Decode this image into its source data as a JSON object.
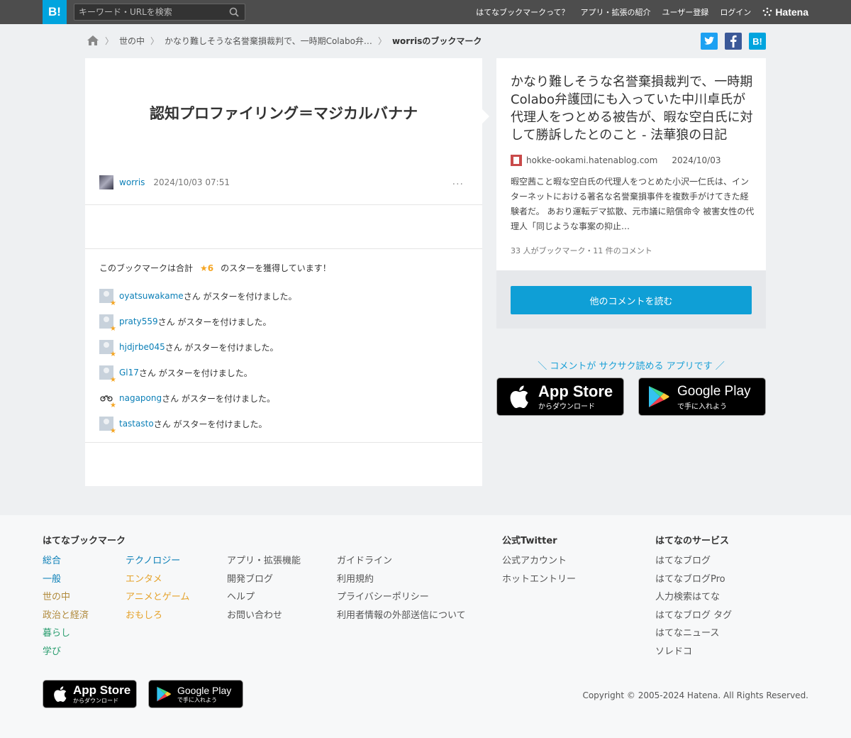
{
  "header": {
    "logo": "B!",
    "search_placeholder": "キーワード・URLを検索",
    "nav": [
      "はてなブックマークって？",
      "アプリ・拡張の紹介",
      "ユーザー登録",
      "ログイン"
    ],
    "hatena_label": "Hatena"
  },
  "breadcrumb": {
    "category": "世の中",
    "entry": "かなり難しそうな名誉棄損裁判で、一時期Colabo弁…",
    "current": "worrisのブックマーク"
  },
  "share": {
    "hatena": "B!"
  },
  "bookmark": {
    "comment": "認知プロファイリング＝マジカルバナナ",
    "user": "worris",
    "timestamp": "2024/10/03 07:51",
    "more": "···",
    "star_prefix": "このブックマークは合計",
    "star_count": "★6",
    "star_suffix": "のスターを獲得しています！",
    "star_users": [
      {
        "name": "oyatsuwakame",
        "suffix": "さん がスターを付けました。"
      },
      {
        "name": "praty559",
        "suffix": "さん がスターを付けました。"
      },
      {
        "name": "hjdjrbe045",
        "suffix": "さん がスターを付けました。"
      },
      {
        "name": "Gl17",
        "suffix": "さん がスターを付けました。"
      },
      {
        "name": "nagapong",
        "suffix": "さん がスターを付けました。"
      },
      {
        "name": "tastasto",
        "suffix": "さん がスターを付けました。"
      }
    ]
  },
  "entry": {
    "title": "かなり難しそうな名誉棄損裁判で、一時期Colabo弁護団にも入っていた中川卓氏が代理人をつとめる被告が、暇な空白氏に対して勝訴したとのこと - 法華狼の日記",
    "domain": "hokke-ookami.hatenablog.com",
    "date": "2024/10/03",
    "summary": "暇空茜こと暇な空白氏の代理人をつとめた小沢一仁氏は、インターネットにおける著名な名誉棄損事件を複数手がけてきた経験者だ。 あおり運転デマ拡散、元市議に賠償命令 被害女性の代理人「同じような事案の抑止…",
    "count": "33 人がブックマーク・11 件のコメント",
    "read_button": "他のコメントを読む"
  },
  "promo": {
    "text": "＼ コメントが サクサク読める アプリです ／",
    "appstore_big": "App Store",
    "appstore_small": "からダウンロード",
    "googleplay_big": "Google Play",
    "googleplay_small": "で手に入れよう"
  },
  "footer": {
    "heading_bookmark": "はてなブックマーク",
    "col1": [
      "総合",
      "一般",
      "世の中",
      "政治と経済",
      "暮らし",
      "学び"
    ],
    "col2": [
      "テクノロジー",
      "エンタメ",
      "アニメとゲーム",
      "おもしろ"
    ],
    "col3": [
      "アプリ・拡張機能",
      "開発ブログ",
      "ヘルプ",
      "お問い合わせ"
    ],
    "col4": [
      "ガイドライン",
      "利用規約",
      "プライバシーポリシー",
      "利用者情報の外部送信について"
    ],
    "heading_twitter": "公式Twitter",
    "twitter": [
      "公式アカウント",
      "ホットエントリー"
    ],
    "heading_services": "はてなのサービス",
    "services": [
      "はてなブログ",
      "はてなブログPro",
      "人力検索はてな",
      "はてなブログ タグ",
      "はてなニュース",
      "ソレドコ"
    ],
    "copyright": "Copyright © 2005-2024 Hatena. All Rights Reserved."
  },
  "colors": {
    "accent": "#00a4de",
    "link": "#0b7fb7",
    "star": "#f5a623",
    "col1": [
      "#0b7fb7",
      "#0b7fb7",
      "#b08a3c",
      "#b08a3c",
      "#2a9d6f",
      "#2a9d6f"
    ],
    "col2": [
      "#0b7fb7",
      "#e5a22a",
      "#e5a22a",
      "#e5a22a"
    ]
  }
}
